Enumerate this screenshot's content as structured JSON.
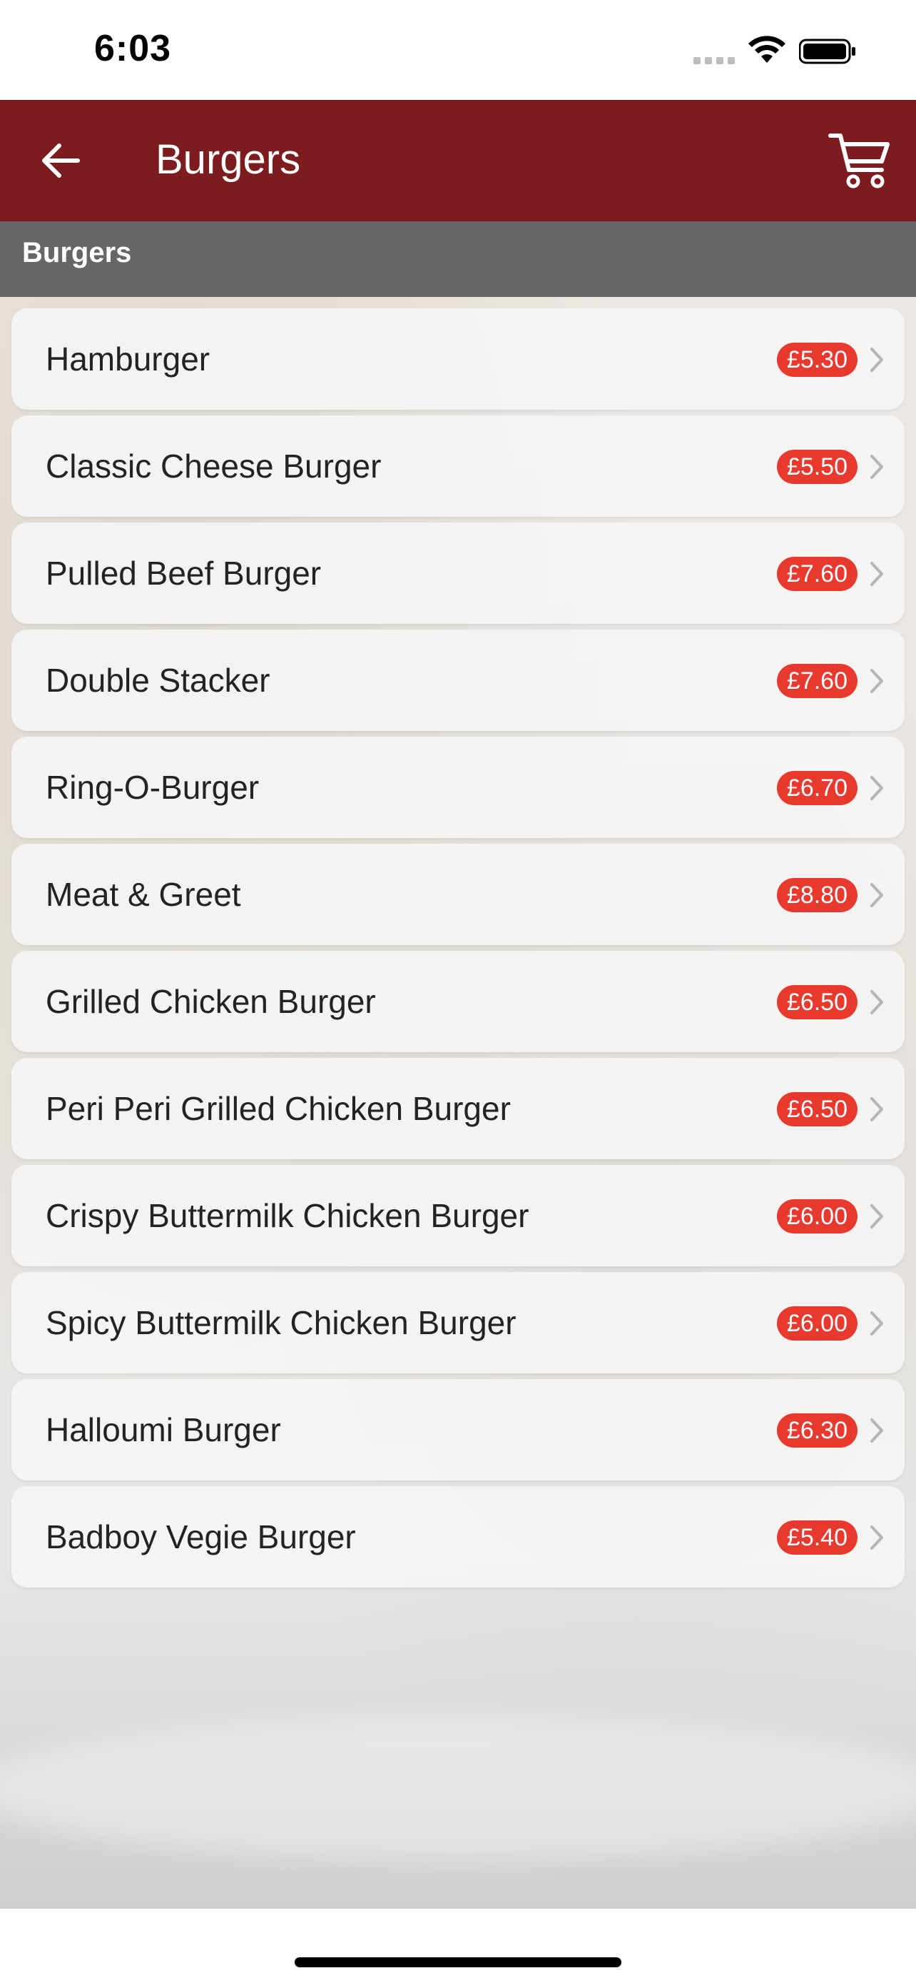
{
  "status_bar": {
    "time": "6:03"
  },
  "header": {
    "title": "Burgers",
    "back_icon": "arrow-left-icon",
    "cart_icon": "shopping-cart-icon"
  },
  "section": {
    "label": "Burgers"
  },
  "colors": {
    "header_bg": "#7c1c1e",
    "section_bg": "#666666",
    "price_badge": "#e8392e"
  },
  "menu_items": [
    {
      "name": "Hamburger",
      "price": "£5.30"
    },
    {
      "name": "Classic Cheese Burger",
      "price": "£5.50"
    },
    {
      "name": "Pulled Beef Burger",
      "price": "£7.60"
    },
    {
      "name": "Double Stacker",
      "price": "£7.60"
    },
    {
      "name": "Ring-O-Burger",
      "price": "£6.70"
    },
    {
      "name": "Meat & Greet",
      "price": "£8.80"
    },
    {
      "name": "Grilled Chicken Burger",
      "price": "£6.50"
    },
    {
      "name": "Peri Peri Grilled Chicken Burger",
      "price": "£6.50"
    },
    {
      "name": "Crispy Buttermilk Chicken Burger",
      "price": "£6.00"
    },
    {
      "name": "Spicy Buttermilk Chicken Burger",
      "price": "£6.00"
    },
    {
      "name": "Halloumi Burger",
      "price": "£6.30"
    },
    {
      "name": "Badboy Vegie Burger",
      "price": "£5.40"
    }
  ]
}
